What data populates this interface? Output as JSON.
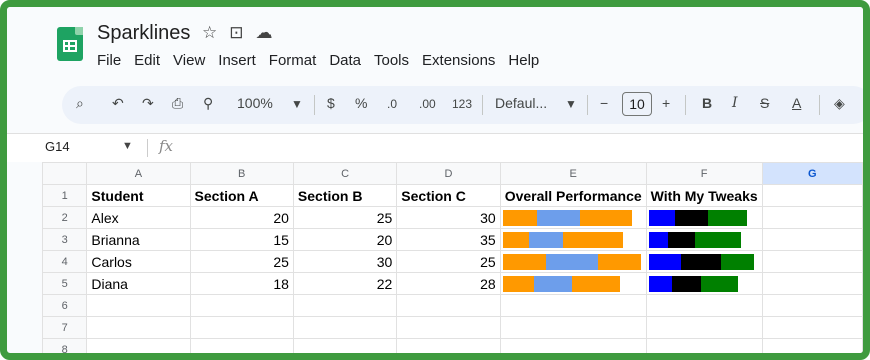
{
  "app": {
    "title": "Sparklines",
    "title_icons": [
      "star-icon",
      "move-to-folder-icon",
      "cloud-status-icon"
    ]
  },
  "menu": [
    "File",
    "Edit",
    "View",
    "Insert",
    "Format",
    "Data",
    "Tools",
    "Extensions",
    "Help"
  ],
  "toolbar": {
    "zoom": "100%",
    "currency": "$",
    "percent": "%",
    "decrease_decimal": ".0",
    "increase_decimal": ".00",
    "more_formats": "123",
    "font": "Defaul...",
    "font_size": "10",
    "minus": "−",
    "plus": "+",
    "bold": "B",
    "italic": "I",
    "strike": "S",
    "text_color": "A"
  },
  "formula_bar": {
    "cell_ref": "G14",
    "fx": "fx"
  },
  "sheet": {
    "columns": [
      "A",
      "B",
      "C",
      "D",
      "E",
      "F",
      "G"
    ],
    "row_numbers": [
      "1",
      "2",
      "3",
      "4",
      "5",
      "6",
      "7",
      "8"
    ],
    "header_row": [
      "Student",
      "Section A",
      "Section B",
      "Section C",
      "Overall Performance",
      "With My Tweaks"
    ],
    "rows": [
      {
        "name": "Alex",
        "a": "20",
        "b": "25",
        "c": "30"
      },
      {
        "name": "Brianna",
        "a": "15",
        "b": "20",
        "c": "35"
      },
      {
        "name": "Carlos",
        "a": "25",
        "b": "30",
        "c": "25"
      },
      {
        "name": "Diana",
        "a": "18",
        "b": "22",
        "c": "28"
      }
    ],
    "sparkline_values": [
      [
        20,
        25,
        30
      ],
      [
        15,
        20,
        35
      ],
      [
        25,
        30,
        25
      ],
      [
        18,
        22,
        28
      ]
    ],
    "sparkline_colors_e": [
      "#ff9900",
      "#6d9eeb",
      "#ff9900"
    ],
    "sparkline_colors_f": [
      "#0000ff",
      "#000000",
      "#008000"
    ]
  }
}
